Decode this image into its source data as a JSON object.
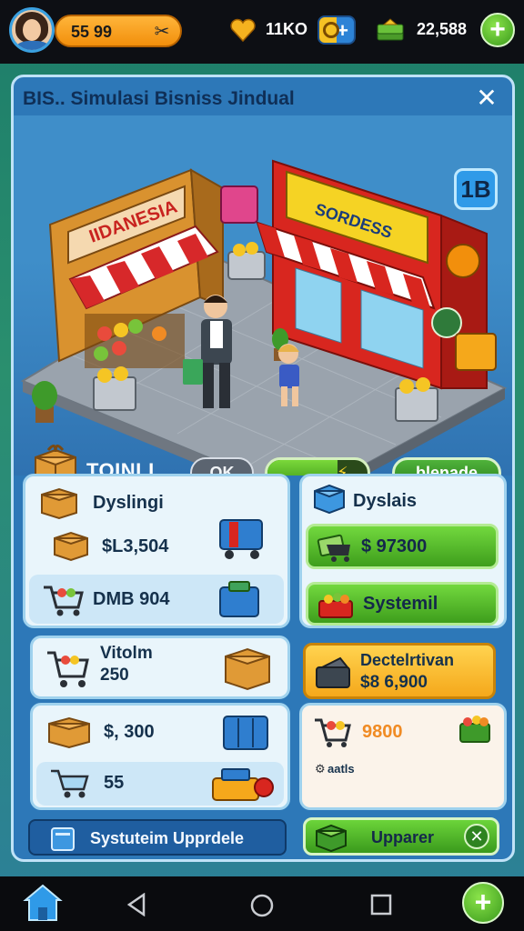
{
  "status_bar": {
    "money_value": "55 99",
    "gems_value": "11KO",
    "cash_value": "22,588",
    "plus_symbol": "+"
  },
  "panel": {
    "title": "BIS.. Simulasi Bisniss Jindual",
    "close_symbol": "✕",
    "level_badge": "1B",
    "scene": {
      "left_shop_sign": "IIDANESIA",
      "right_shop_sign": "SORDESS",
      "total_label": "TOINLI",
      "toggle_label": "OK",
      "progress_fraction": 0.7,
      "blank_button_label": "blenade"
    }
  },
  "cards": {
    "card1": {
      "title": "Dyslingi",
      "amount": "$L3,504",
      "sub_value": "DMB 904"
    },
    "card2": {
      "title": "Vitolm",
      "value": "250"
    },
    "card3": {
      "amount": "$, 300",
      "sub_value": "55"
    },
    "card4": {
      "title": "Dyslais",
      "price_value": "$ 97300",
      "system_label": "Systemil"
    },
    "card5": {
      "title": "Dectelrtivan",
      "amount": "$8 6,900"
    },
    "card6": {
      "amount": "9800",
      "small_label": "aatls"
    }
  },
  "upgrades": {
    "left_label": "Systuteim Upprdele",
    "right_label": "Upparer"
  },
  "colors": {
    "panel_blue": "#2d78b8",
    "accent_green": "#4fb23a",
    "accent_orange": "#f5a81b"
  }
}
